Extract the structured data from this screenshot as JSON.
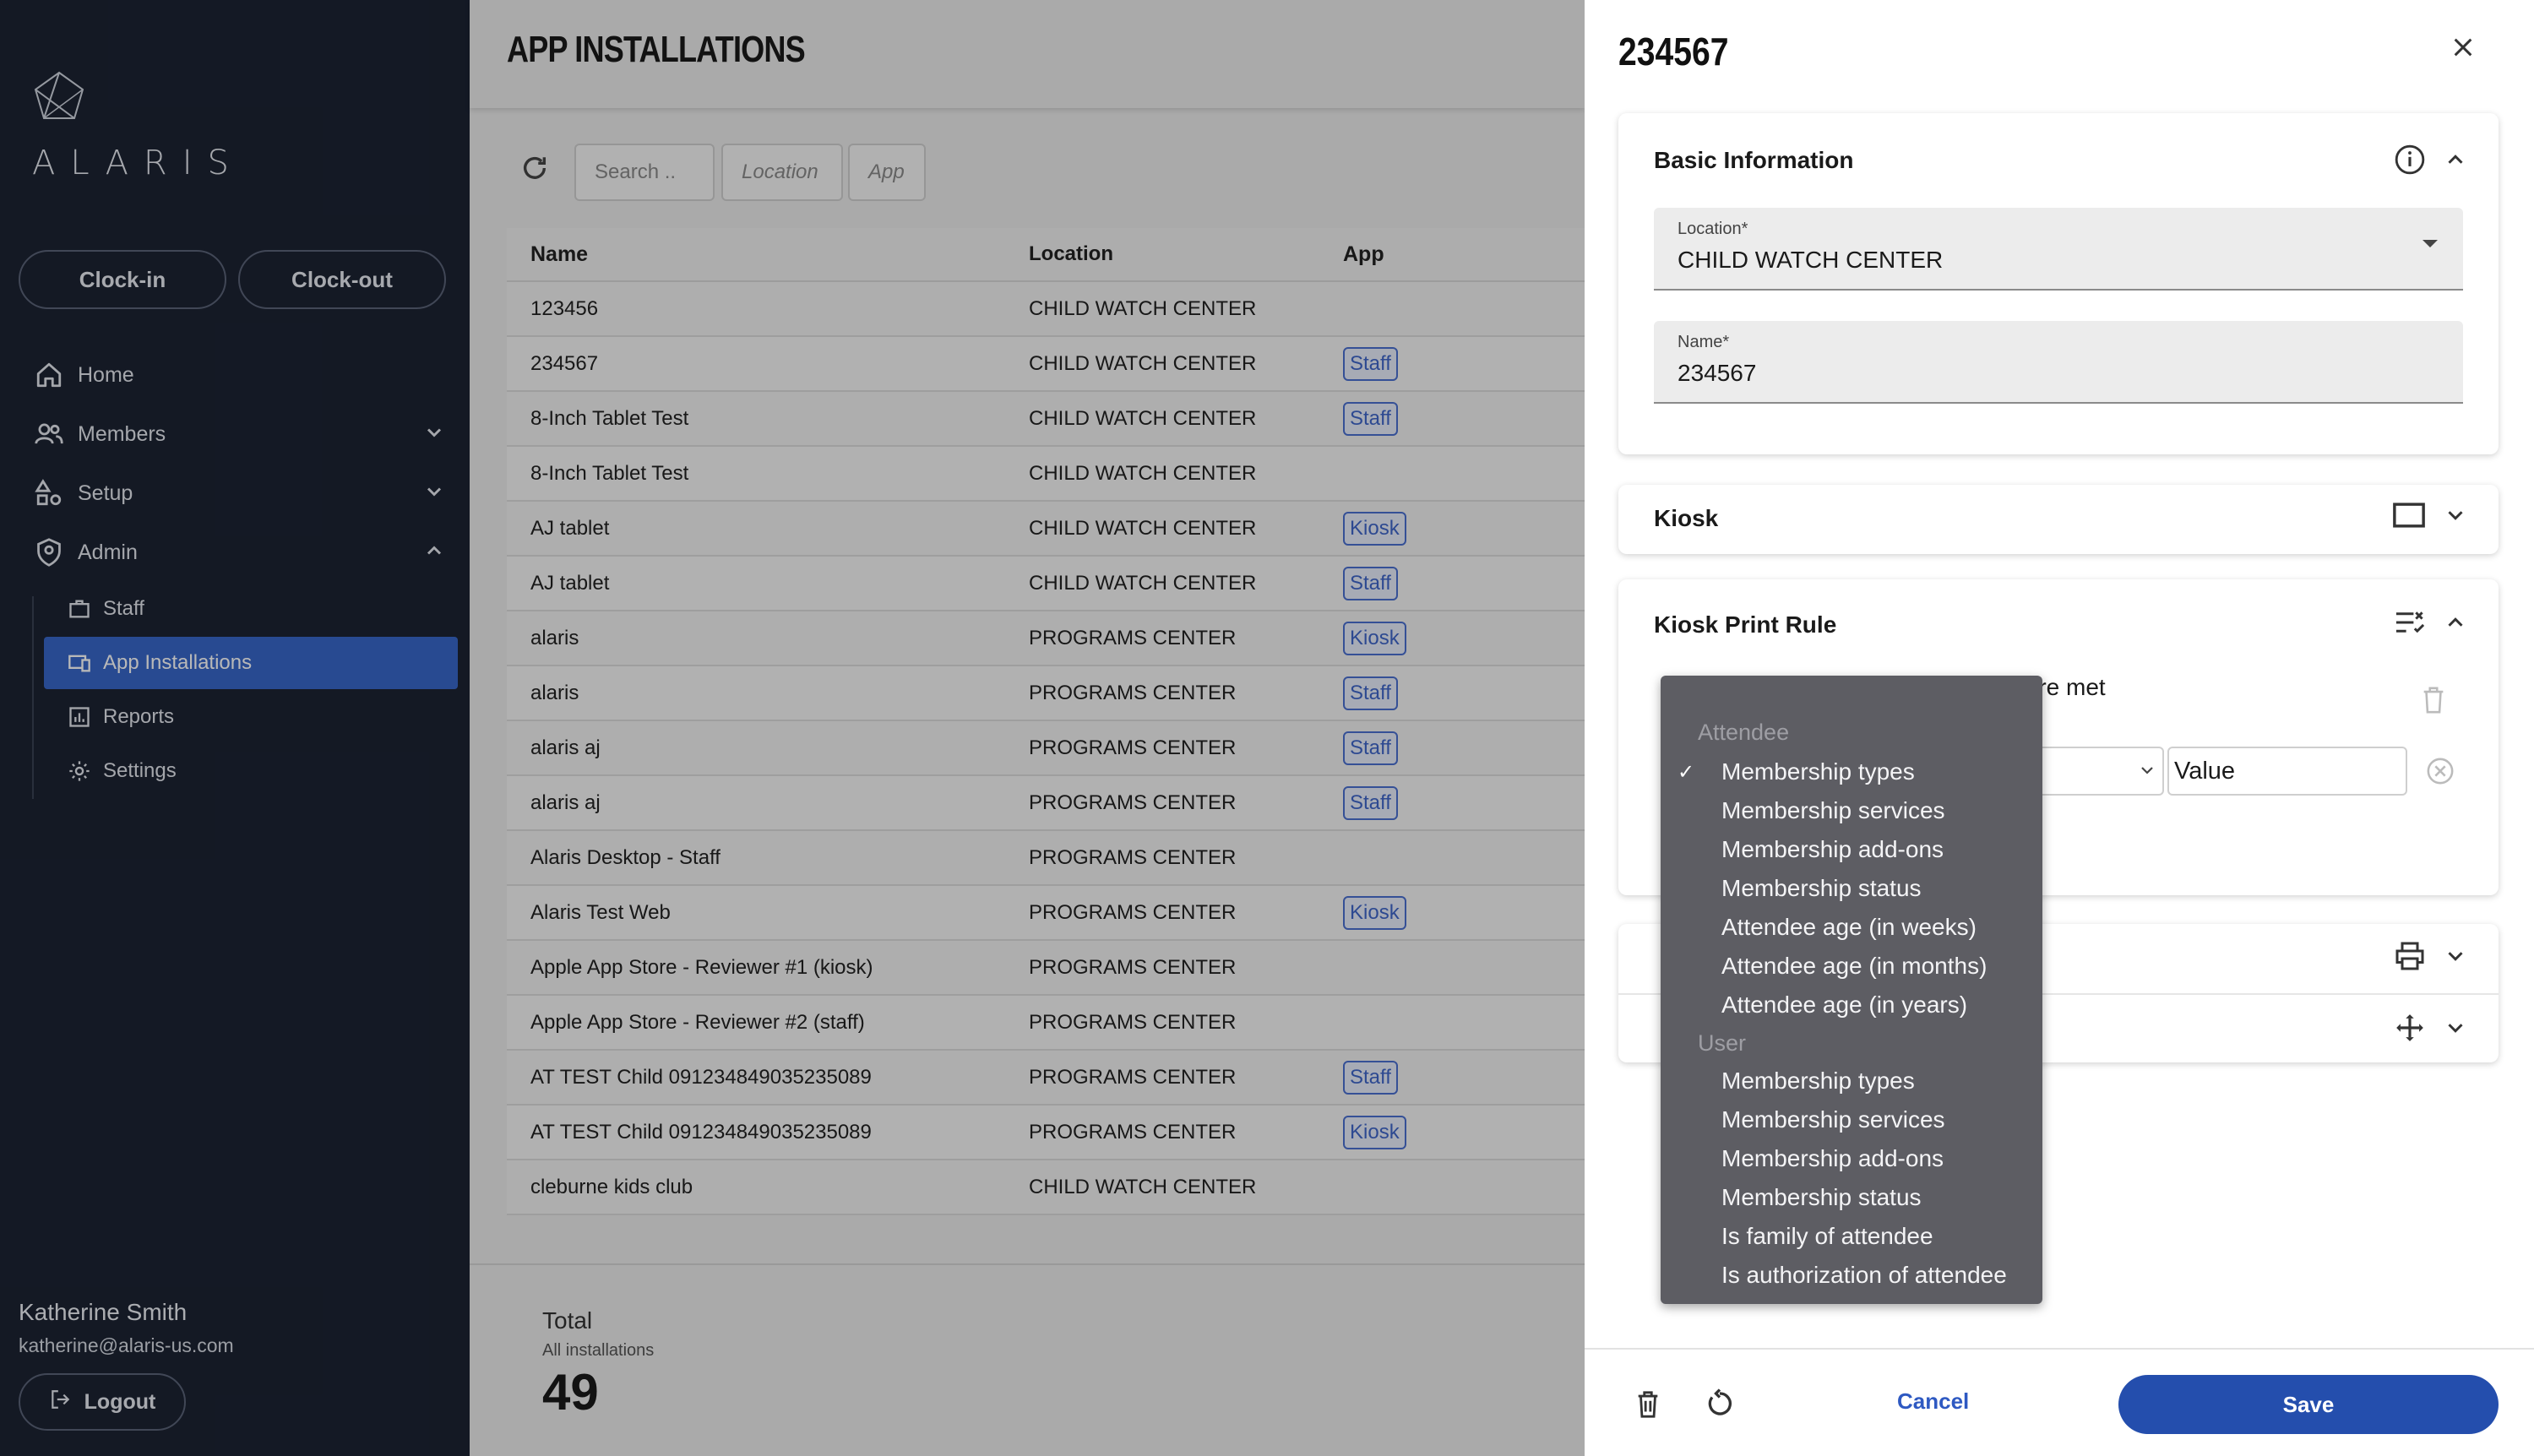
{
  "sidebar": {
    "logo_text": "ALARIS",
    "clock_in": "Clock-in",
    "clock_out": "Clock-out",
    "nav": [
      {
        "label": "Home"
      },
      {
        "label": "Members"
      },
      {
        "label": "Setup"
      },
      {
        "label": "Admin"
      }
    ],
    "admin_items": [
      {
        "label": "Staff"
      },
      {
        "label": "App Installations"
      },
      {
        "label": "Reports"
      },
      {
        "label": "Settings"
      }
    ],
    "user_name": "Katherine Smith",
    "user_email": "katherine@alaris-us.com",
    "logout": "Logout"
  },
  "main": {
    "title": "APP INSTALLATIONS",
    "search_placeholder": "Search ..",
    "location_filter": "Location",
    "app_filter": "App",
    "columns": [
      "Name",
      "Location",
      "App"
    ],
    "rows": [
      {
        "name": "123456",
        "location": "CHILD WATCH CENTER",
        "app": ""
      },
      {
        "name": "234567",
        "location": "CHILD WATCH CENTER",
        "app": "Staff"
      },
      {
        "name": "8-Inch Tablet Test",
        "location": "CHILD WATCH CENTER",
        "app": "Staff"
      },
      {
        "name": "8-Inch Tablet Test",
        "location": "CHILD WATCH CENTER",
        "app": ""
      },
      {
        "name": "AJ tablet",
        "location": "CHILD WATCH CENTER",
        "app": "Kiosk"
      },
      {
        "name": "AJ tablet",
        "location": "CHILD WATCH CENTER",
        "app": "Staff"
      },
      {
        "name": "alaris",
        "location": "PROGRAMS CENTER",
        "app": "Kiosk"
      },
      {
        "name": "alaris",
        "location": "PROGRAMS CENTER",
        "app": "Staff"
      },
      {
        "name": "alaris aj",
        "location": "PROGRAMS CENTER",
        "app": "Staff"
      },
      {
        "name": "alaris aj",
        "location": "PROGRAMS CENTER",
        "app": "Staff"
      },
      {
        "name": "Alaris Desktop - Staff",
        "location": "PROGRAMS CENTER",
        "app": ""
      },
      {
        "name": "Alaris Test Web",
        "location": "PROGRAMS CENTER",
        "app": "Kiosk"
      },
      {
        "name": "Apple App Store - Reviewer #1 (kiosk)",
        "location": "PROGRAMS CENTER",
        "app": ""
      },
      {
        "name": "Apple App Store - Reviewer #2 (staff)",
        "location": "PROGRAMS CENTER",
        "app": ""
      },
      {
        "name": "AT TEST Child 091234849035235089",
        "location": "PROGRAMS CENTER",
        "app": "Staff"
      },
      {
        "name": "AT TEST Child 091234849035235089",
        "location": "PROGRAMS CENTER",
        "app": "Kiosk"
      },
      {
        "name": "cleburne kids club",
        "location": "CHILD WATCH CENTER",
        "app": ""
      }
    ],
    "total_label": "Total",
    "total_sub": "All installations",
    "total_value": "49"
  },
  "drawer": {
    "title": "234567",
    "basic_info_title": "Basic Information",
    "location_label": "Location*",
    "location_value": "CHILD WATCH CENTER",
    "name_label": "Name*",
    "name_value": "234567",
    "kiosk_title": "Kiosk",
    "print_rule_title": "Kiosk Print Rule",
    "rule_text": "s are met",
    "value_placeholder": "Value",
    "cancel": "Cancel",
    "save": "Save"
  },
  "dropdown": {
    "group1": "Attendee",
    "group1_items": [
      "Membership types",
      "Membership services",
      "Membership add-ons",
      "Membership status",
      "Attendee age (in weeks)",
      "Attendee age (in months)",
      "Attendee age (in years)"
    ],
    "group2": "User",
    "group2_items": [
      "Membership types",
      "Membership services",
      "Membership add-ons",
      "Membership status",
      "Is family of attendee",
      "Is authorization of attendee"
    ],
    "selected": "Membership types"
  },
  "colors": {
    "sidebar_bg": "#1c2333",
    "active_nav": "#3867c9",
    "primary_button": "#244ead",
    "badge": "#3f66c9"
  }
}
